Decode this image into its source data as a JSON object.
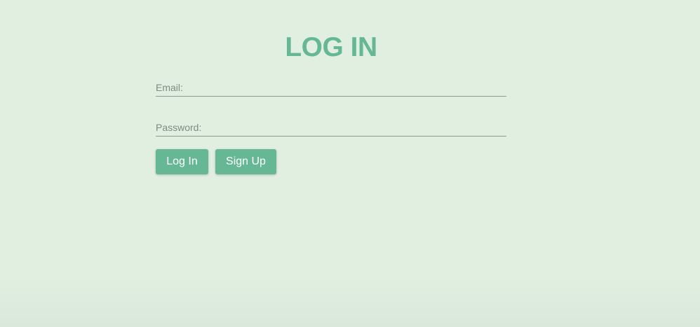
{
  "form": {
    "title": "LOG IN",
    "email": {
      "label": "Email:",
      "value": ""
    },
    "password": {
      "label": "Password:",
      "value": ""
    },
    "buttons": {
      "login": "Log In",
      "signup": "Sign Up"
    }
  },
  "colors": {
    "accent": "#66b894",
    "background": "#e1efe1",
    "label": "#7f8a80",
    "underline": "#8f9b90"
  }
}
